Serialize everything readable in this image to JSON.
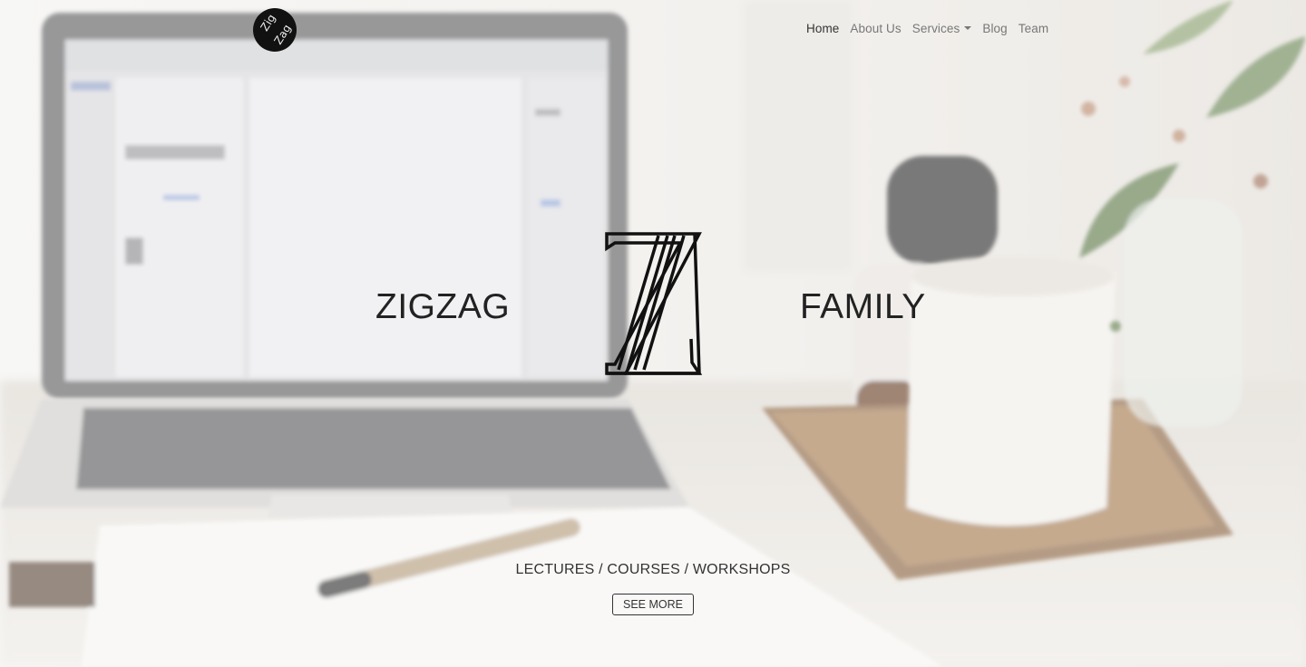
{
  "logo": {
    "line1": "Zig",
    "line2": "Zag"
  },
  "nav": {
    "items": [
      {
        "label": "Home",
        "active": true
      },
      {
        "label": "About Us",
        "active": false
      },
      {
        "label": "Services",
        "active": false,
        "dropdown": true
      },
      {
        "label": "Blog",
        "active": false
      },
      {
        "label": "Team",
        "active": false
      }
    ]
  },
  "hero": {
    "title_left": "ZIGZAG",
    "title_right": "FAMILY",
    "emblem_icon": "z-letter-icon",
    "tagline": "LECTURES / COURSES / WORKSHOPS",
    "cta_label": "SEE MORE"
  },
  "colors": {
    "text": "#222222",
    "nav_text": "#777777",
    "nav_active": "#333333",
    "background_tint": "#e9e6e1"
  }
}
